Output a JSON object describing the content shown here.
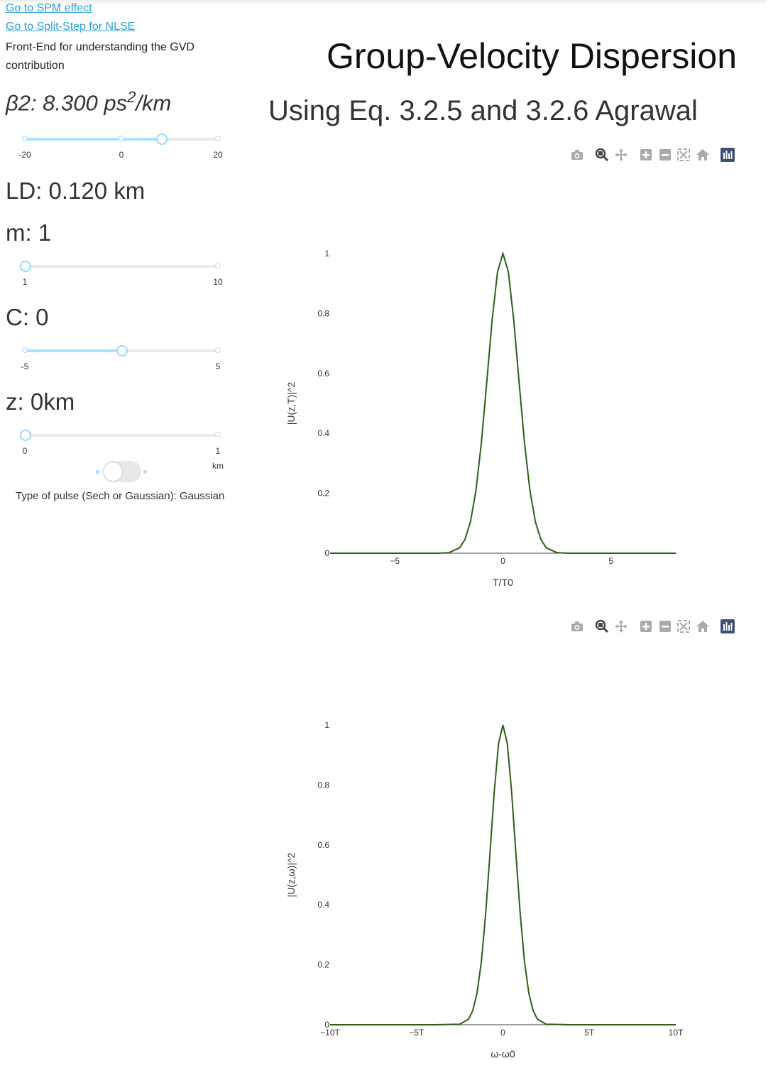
{
  "nav": {
    "link_spm": "Go to SPM effect",
    "link_split": "Go to Split-Step for NLSE",
    "description": "Front-End for understanding the GVD contribution"
  },
  "controls": {
    "beta2": {
      "label": "β2: 8.300 ps",
      "sup": "2",
      "unit": "/km",
      "min": -20,
      "max": 20,
      "value": 8.3,
      "marks": [
        "-20",
        "0",
        "20"
      ]
    },
    "ld_label": "LD: 0.120 km",
    "m": {
      "label": "m: 1",
      "min": 1,
      "max": 10,
      "value": 1,
      "marks": [
        "1",
        "10"
      ]
    },
    "c": {
      "label": "C: 0",
      "min": -5,
      "max": 5,
      "value": 0,
      "marks": [
        "-5",
        "5"
      ]
    },
    "z": {
      "label": "z: 0km",
      "min": 0,
      "max": 1,
      "value": 0,
      "marks": [
        "0",
        "1"
      ],
      "unit_mark": "km"
    },
    "pulse_type": "Type of pulse (Sech or Gaussian): Gaussian"
  },
  "header": {
    "title": "Group-Velocity Dispersion",
    "subtitle": "Using Eq. 3.2.5 and 3.2.6 Agrawal"
  },
  "modebar": {
    "icons": [
      "camera-icon",
      "zoom-icon",
      "pan-icon",
      "zoom-in-icon",
      "zoom-out-icon",
      "autoscale-icon",
      "reset-axes-icon",
      "plotly-logo-icon"
    ]
  },
  "colors": {
    "trace": "#2d5f18",
    "accent": "#96dbfa",
    "link": "#2e9fd6"
  },
  "chart_data": [
    {
      "type": "line",
      "xlabel": "T/T0",
      "ylabel": "|U(z,T)|^2",
      "xlim": [
        -8,
        8
      ],
      "ylim": [
        0,
        1
      ],
      "x_ticks": [
        "−5",
        "0",
        "5"
      ],
      "x_tick_values": [
        -5,
        0,
        5
      ],
      "y_ticks": [
        "0",
        "0.2",
        "0.4",
        "0.6",
        "0.8",
        "1"
      ],
      "y_tick_values": [
        0,
        0.2,
        0.4,
        0.6,
        0.8,
        1
      ],
      "series": [
        {
          "x": [
            -8,
            -4,
            -3,
            -2.5,
            -2,
            -1.75,
            -1.5,
            -1.25,
            -1,
            -0.75,
            -0.5,
            -0.25,
            0,
            0.25,
            0.5,
            0.75,
            1,
            1.25,
            1.5,
            1.75,
            2,
            2.5,
            3,
            4,
            8
          ],
          "y": [
            0,
            0,
            0.0001,
            0.0019,
            0.0183,
            0.0468,
            0.1054,
            0.2096,
            0.3679,
            0.5698,
            0.7788,
            0.9394,
            1,
            0.9394,
            0.7788,
            0.5698,
            0.3679,
            0.2096,
            0.1054,
            0.0468,
            0.0183,
            0.0019,
            0.0001,
            0,
            0
          ]
        }
      ]
    },
    {
      "type": "line",
      "xlabel": "ω-ω0",
      "ylabel": "|U(z,ω)|^2",
      "xlim": [
        -10,
        10
      ],
      "ylim": [
        0,
        1
      ],
      "x_ticks": [
        "−10T",
        "−5T",
        "0",
        "5T",
        "10T"
      ],
      "x_tick_values": [
        -10,
        -5,
        0,
        5,
        10
      ],
      "y_ticks": [
        "0",
        "0.2",
        "0.4",
        "0.6",
        "0.8",
        "1"
      ],
      "y_tick_values": [
        0,
        0.2,
        0.4,
        0.6,
        0.8,
        1
      ],
      "series": [
        {
          "x": [
            -10,
            -4,
            -2.5,
            -2,
            -1.75,
            -1.5,
            -1.25,
            -1,
            -0.75,
            -0.5,
            -0.25,
            0,
            0.25,
            0.5,
            0.75,
            1,
            1.25,
            1.5,
            1.75,
            2,
            2.5,
            4,
            10
          ],
          "y": [
            0,
            0,
            0.002,
            0.0183,
            0.0468,
            0.1054,
            0.2096,
            0.3679,
            0.5698,
            0.7788,
            0.9394,
            1,
            0.9394,
            0.7788,
            0.5698,
            0.3679,
            0.2096,
            0.1054,
            0.0468,
            0.0183,
            0.002,
            0,
            0
          ]
        }
      ]
    }
  ]
}
